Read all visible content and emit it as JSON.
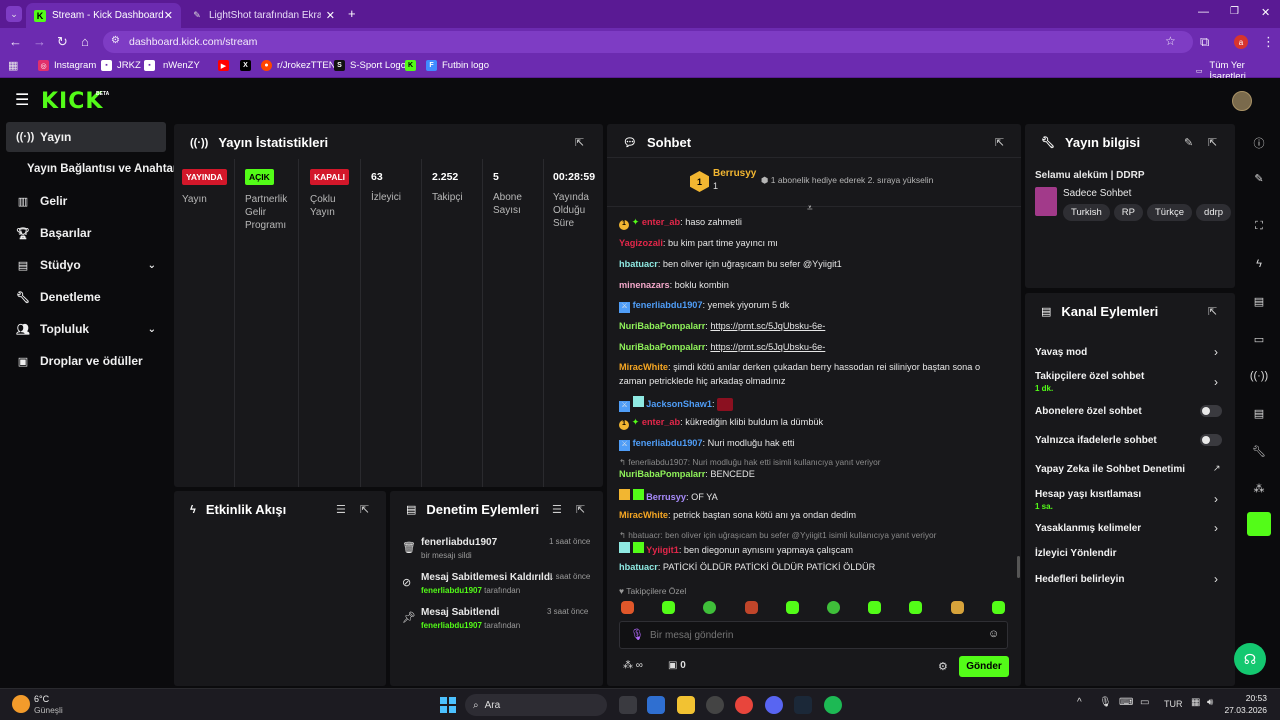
{
  "browser": {
    "tabs": [
      {
        "label": "Stream - Kick Dashboard",
        "active": true
      },
      {
        "label": "LightShot tarafından Ekran Gör",
        "active": false
      }
    ],
    "url": "dashboard.kick.com/stream",
    "profile_letter": "a",
    "bookmarks": [
      "Instagram",
      "JRKZ",
      "nWenZY",
      "r/JrokezTTEN",
      "S-Sport Logo",
      "Futbin logo"
    ],
    "all_bookmarks": "Tüm Yer İşaretleri"
  },
  "kick": {
    "logo": "KICK",
    "beta": "BETA"
  },
  "sidebar": {
    "items": [
      {
        "label": "Yayın",
        "icon": "broadcast-icon"
      },
      {
        "label": "Yayın Bağlantısı ve Anahtarı",
        "icon": ""
      },
      {
        "label": "Gelir",
        "icon": "revenue-icon"
      },
      {
        "label": "Başarılar",
        "icon": "trophy-icon"
      },
      {
        "label": "Stüdyo",
        "icon": "studio-icon"
      },
      {
        "label": "Denetleme",
        "icon": "wrench-icon"
      },
      {
        "label": "Topluluk",
        "icon": "community-icon"
      },
      {
        "label": "Droplar ve ödüller",
        "icon": "gift-icon"
      }
    ]
  },
  "stats": {
    "title": "Yayın İstatistikleri",
    "cols": [
      {
        "badge": "YAYINDA",
        "label": "Yayın"
      },
      {
        "badge": "AÇIK",
        "label": "Partnerlik Gelir Programı"
      },
      {
        "badge": "KAPALI",
        "label": "Çoklu Yayın"
      },
      {
        "value": "63",
        "label": "İzleyici"
      },
      {
        "value": "2.252",
        "label": "Takipçi"
      },
      {
        "value": "5",
        "label": "Abone Sayısı"
      },
      {
        "value": "00:28:59",
        "label": "Yayında Olduğu Süre"
      }
    ]
  },
  "activity": {
    "title": "Etkinlik Akışı"
  },
  "moderation": {
    "title": "Denetim Eylemleri",
    "items": [
      {
        "title": "fenerliabdu1907",
        "sub": "bir mesajı sildi",
        "time": "1 saat önce"
      },
      {
        "title": "Mesaj Sabitlemesi Kaldırıldı",
        "user": "fenerliabdu1907",
        "by": "tarafından",
        "time": "1 saat önce"
      },
      {
        "title": "Mesaj Sabitlendi",
        "user": "fenerliabdu1907",
        "by": "tarafından",
        "time": "3 saat önce"
      }
    ]
  },
  "chat": {
    "title": "Sohbet",
    "top_user": "Berrusyy",
    "top_rank": "1",
    "top_count": "1",
    "top_note": "1 abonelik hediye ederek 2. sıraya yükselin",
    "messages": [
      {
        "user": "enter_ab",
        "color": "#e2274a",
        "text": ": haso zahmetli"
      },
      {
        "user": "Yagizozali",
        "color": "#e2274a",
        "text": ": bu kim part time yayıncı mı"
      },
      {
        "user": "hbatuacr",
        "color": "#8fe9e2",
        "text": ": ben oliver için uğraşıcam bu sefer @Yyiigit1"
      },
      {
        "user": "minenazars",
        "color": "#f2a7c9",
        "text": ": boklu kombin"
      },
      {
        "user": "fenerliabdu1907",
        "color": "#4f9df7",
        "text": ": yemek yiyorum 5 dk"
      },
      {
        "user": "NuriBabaPompalarr",
        "color": "#8ff25a",
        "text": ": ",
        "link": "https://prnt.sc/5JqUbsku-6e-"
      },
      {
        "user": "NuriBabaPompalarr",
        "color": "#8ff25a",
        "text": ": ",
        "link": "https://prnt.sc/5JqUbsku-6e-"
      },
      {
        "user": "MiracWhite",
        "color": "#f5a623",
        "text": ": şimdi kötü anılar derken çukadan berry hassodan rei siliniyor baştan sona o",
        "text2": "zaman petricklede hiç arkadaş olmadınız"
      },
      {
        "user": "JacksonShaw1",
        "color": "#4f9df7",
        "text": ":"
      },
      {
        "user": "enter_ab",
        "color": "#e2274a",
        "text": ": kükrediğin klibi buldum la dümbük"
      },
      {
        "user": "fenerliabdu1907",
        "color": "#4f9df7",
        "text": ": Nuri modluğu hak etti"
      },
      {
        "reply": "fenerliabdu1907: Nuri modluğu hak etti isimli kullanıcıya yanıt veriyor"
      },
      {
        "user": "NuriBabaPompalarr",
        "color": "#8ff25a",
        "text": ": BENCEDE"
      },
      {
        "user": "Berrusyy",
        "color": "#a78bfa",
        "text": ": OF YA"
      },
      {
        "user": "MiracWhite",
        "color": "#f5a623",
        "text": ": petrick baştan sona kötü anı ya ondan dedim"
      },
      {
        "reply": "hbatuacr: ben oliver için uğraşıcam bu sefer @Yyiigit1 isimli kullanıcıya yanıt veriyor"
      },
      {
        "user": "Yyiigit1",
        "color": "#e2274a",
        "text": ": ben diegonun aynısını yapmaya çalışcam"
      },
      {
        "user": "hbatuacr",
        "color": "#8fe9e2",
        "text": ": PATİCKİ ÖLDÜR PATİCKİ ÖLDÜR PATİCKİ ÖLDÜR"
      }
    ],
    "followers_only": "Takipçilere Özel",
    "input_placeholder": "Bir mesaj gönderin",
    "points": "∞",
    "count": "0",
    "send": "Gönder"
  },
  "stream_info": {
    "title": "Yayın bilgisi",
    "stream_title": "Selamu aleküm | DDRP",
    "category": "Sadece Sohbet",
    "tags": [
      "Turkish",
      "RP",
      "Türkçe",
      "ddrp"
    ]
  },
  "channel_actions": {
    "title": "Kanal Eylemleri",
    "items": [
      {
        "label": "Yavaş mod",
        "type": "chev"
      },
      {
        "label": "Takipçilere özel sohbet",
        "sub": "1 dk.",
        "type": "chev"
      },
      {
        "label": "Abonelere özel sohbet",
        "type": "toggle"
      },
      {
        "label": "Yalnızca ifadelerle sohbet",
        "type": "toggle"
      },
      {
        "label": "Yapay Zeka ile Sohbet Denetimi",
        "type": "ext"
      },
      {
        "label": "Hesap yaşı kısıtlaması",
        "sub": "1 sa.",
        "type": "chev"
      },
      {
        "label": "Yasaklanmış kelimeler",
        "type": "chev"
      },
      {
        "label": "İzleyici Yönlendir",
        "type": "none"
      },
      {
        "label": "Hedefleri belirleyin",
        "type": "chev"
      }
    ]
  },
  "taskbar": {
    "weather_temp": "6°C",
    "weather_desc": "Güneşli",
    "search": "Ara",
    "lang": "TUR",
    "time": "20:53",
    "date": "27.03.2026"
  },
  "colors": {
    "kick_green": "#53fc18",
    "purple": "#6c2bb0",
    "panel": "#18181b"
  }
}
